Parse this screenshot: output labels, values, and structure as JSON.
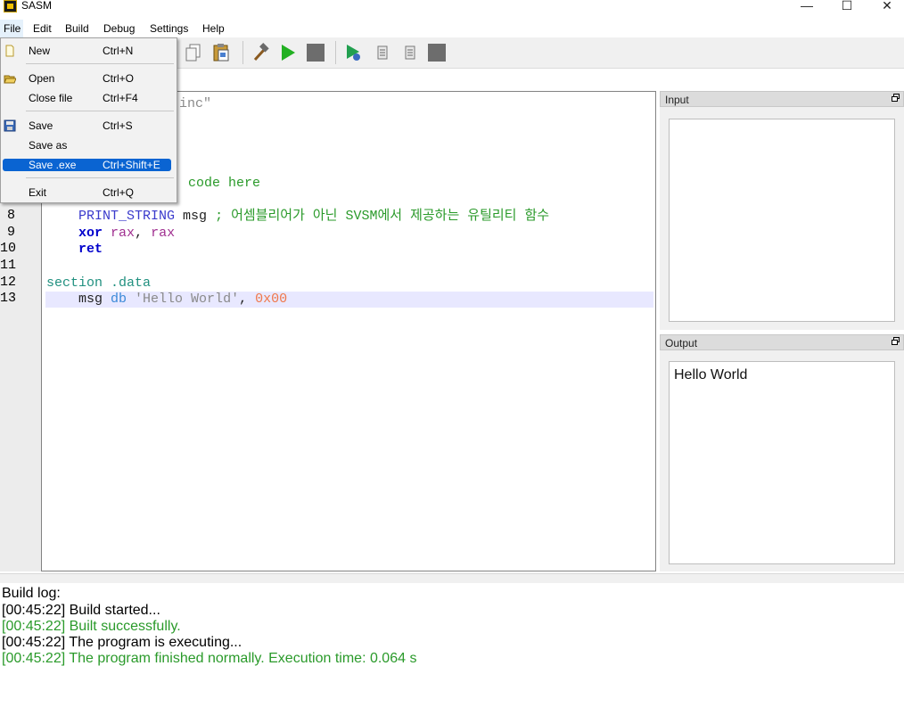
{
  "window": {
    "title": "SASM",
    "minimize_glyph": "—",
    "maximize_glyph": "☐",
    "close_glyph": "✕"
  },
  "menubar": {
    "items": [
      "File",
      "Edit",
      "Build",
      "Debug",
      "Settings",
      "Help"
    ]
  },
  "file_menu": {
    "items": [
      {
        "label": "New",
        "shortcut": "Ctrl+N",
        "icon": "new-file-icon"
      },
      {
        "label": "Open",
        "shortcut": "Ctrl+O",
        "icon": "open-folder-icon"
      },
      {
        "label": "Close file",
        "shortcut": "Ctrl+F4",
        "icon": ""
      },
      {
        "label": "Save",
        "shortcut": "Ctrl+S",
        "icon": "save-disk-icon"
      },
      {
        "label": "Save as",
        "shortcut": "",
        "icon": ""
      },
      {
        "label": "Save .exe",
        "shortcut": "Ctrl+Shift+E",
        "icon": "",
        "selected": true
      },
      {
        "label": "Exit",
        "shortcut": "Ctrl+Q",
        "icon": ""
      }
    ]
  },
  "editor": {
    "visible_fragments": {
      "line1_tail": "inc\"",
      "line5_tail": "code here"
    },
    "lines": [
      {
        "num": "8",
        "text": "    PRINT_STRING msg ; 어셈블리어가 아닌 SVSM에서 제공하는 유틸리티 함수"
      },
      {
        "num": "9",
        "text": "    xor rax, rax"
      },
      {
        "num": "10",
        "text": "    ret"
      },
      {
        "num": "11",
        "text": ""
      },
      {
        "num": "12",
        "text": "section .data"
      },
      {
        "num": "13",
        "text": "    msg db 'Hello World', 0x00"
      }
    ]
  },
  "input_panel": {
    "title": "Input",
    "value": ""
  },
  "output_panel": {
    "title": "Output",
    "value": "Hello World"
  },
  "build_log": {
    "title": "Build log:",
    "entries": [
      {
        "text": "[00:45:22] Build started...",
        "color": "#000000"
      },
      {
        "text": "[00:45:22] Built successfully.",
        "color": "#2a9a2a"
      },
      {
        "text": "[00:45:22] The program is executing...",
        "color": "#000000"
      },
      {
        "text": "[00:45:22] The program finished normally. Execution time: 0.064 s",
        "color": "#2a9a2a"
      }
    ]
  },
  "colors": {
    "selection": "#0a64d2",
    "success": "#2a9a2a",
    "current_line": "#e8e8ff"
  }
}
